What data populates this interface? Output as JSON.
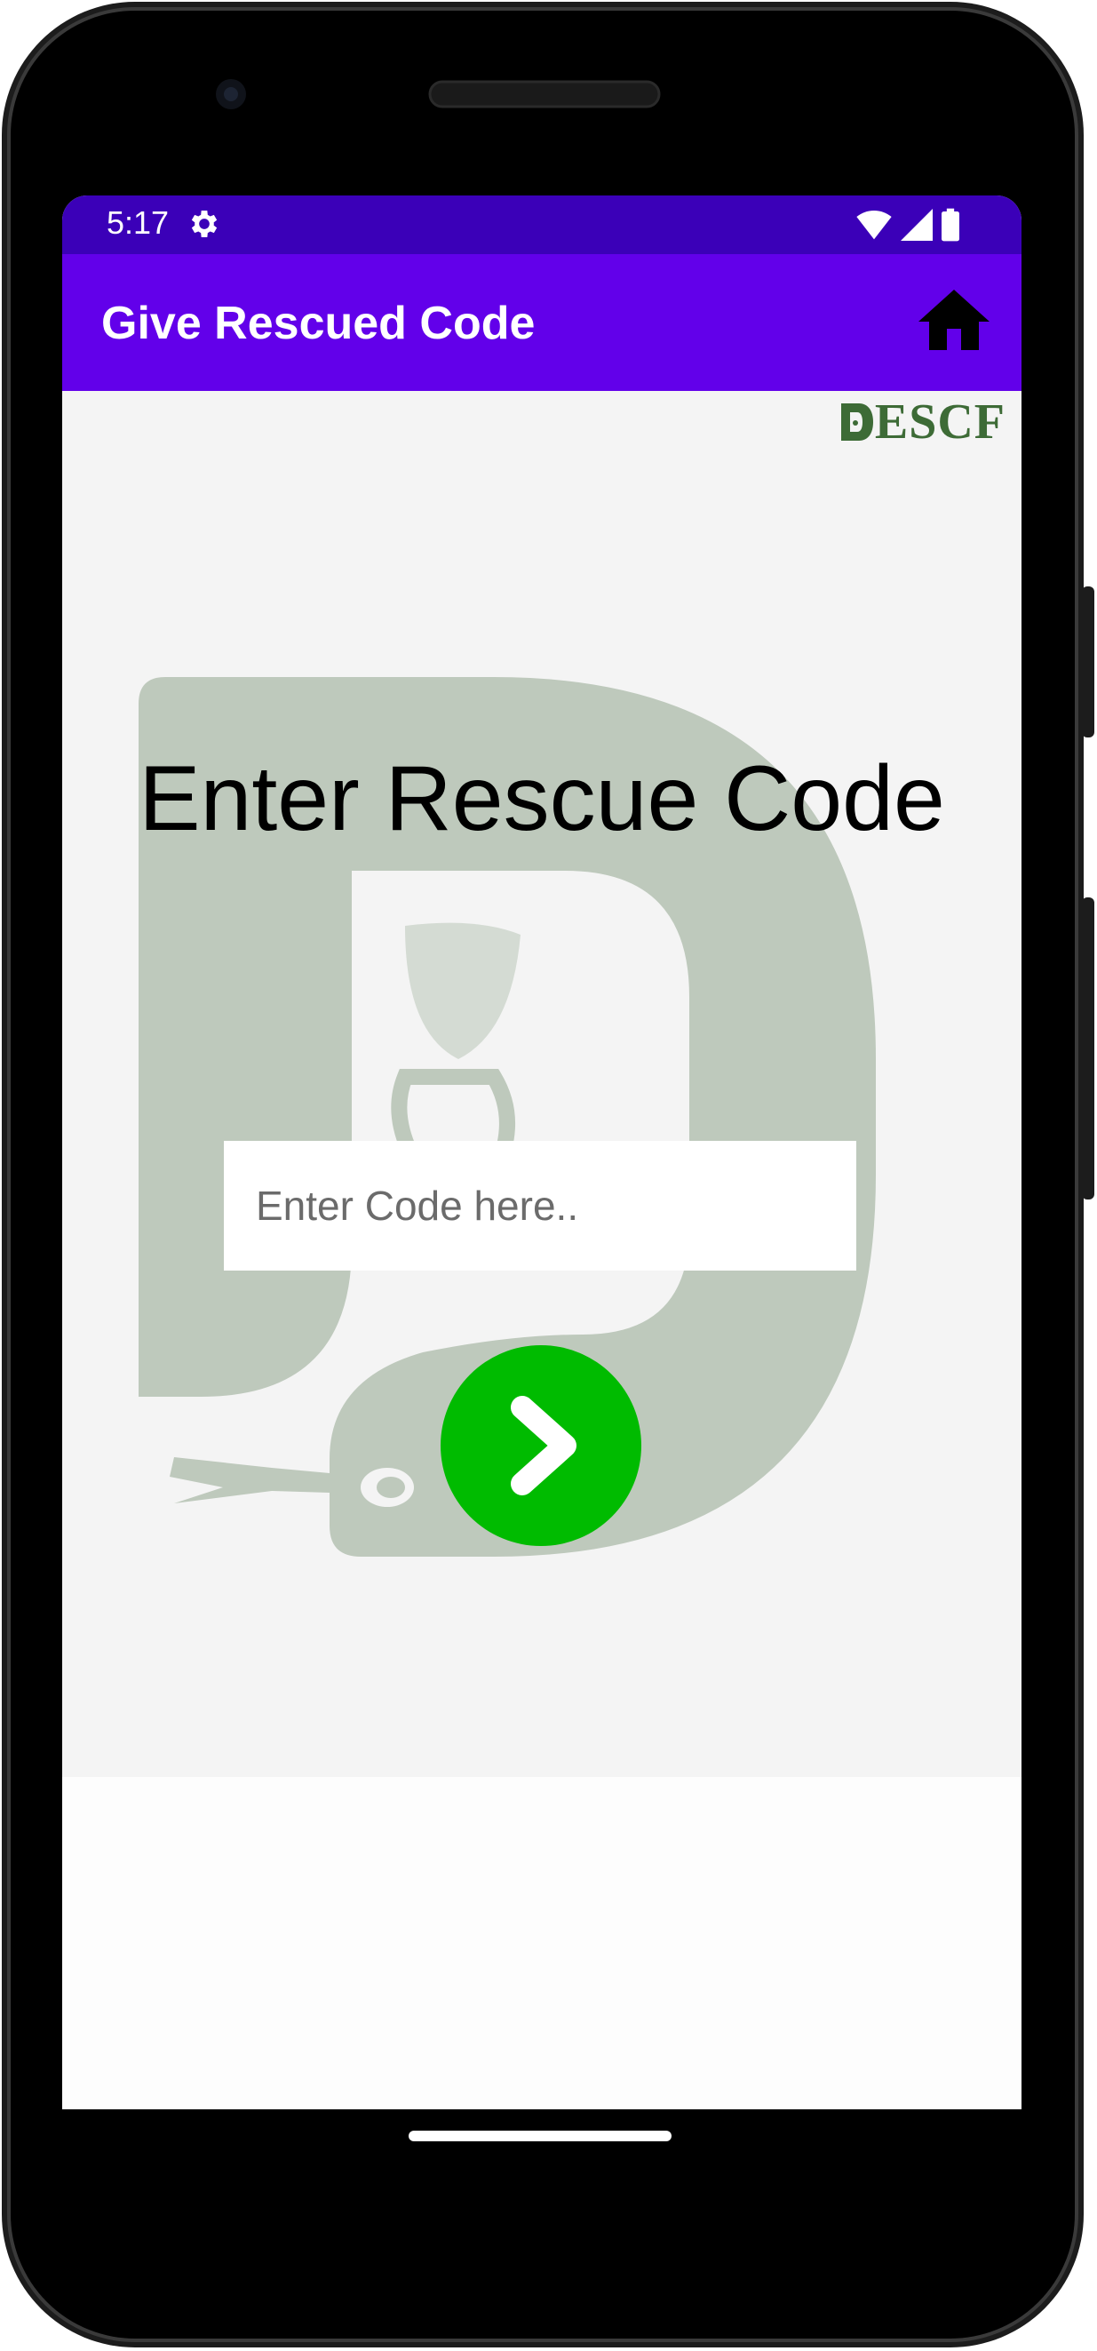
{
  "status_bar": {
    "time": "5:17",
    "icons": [
      "settings-gear-icon",
      "wifi-icon",
      "cell-signal-icon",
      "battery-icon"
    ],
    "background_color": "#3b00b8"
  },
  "app_bar": {
    "title": "Give Rescued Code",
    "home_icon": "home-icon",
    "background_color": "#6200ea"
  },
  "content": {
    "brand_logo_text": "ESCF",
    "watermark": "snake-logo-watermark",
    "heading": "Enter Rescue Code",
    "code_input": {
      "placeholder": "Enter Code here..",
      "value": ""
    },
    "submit_button_icon": "chevron-right-icon",
    "submit_button_color": "#00bb00"
  }
}
